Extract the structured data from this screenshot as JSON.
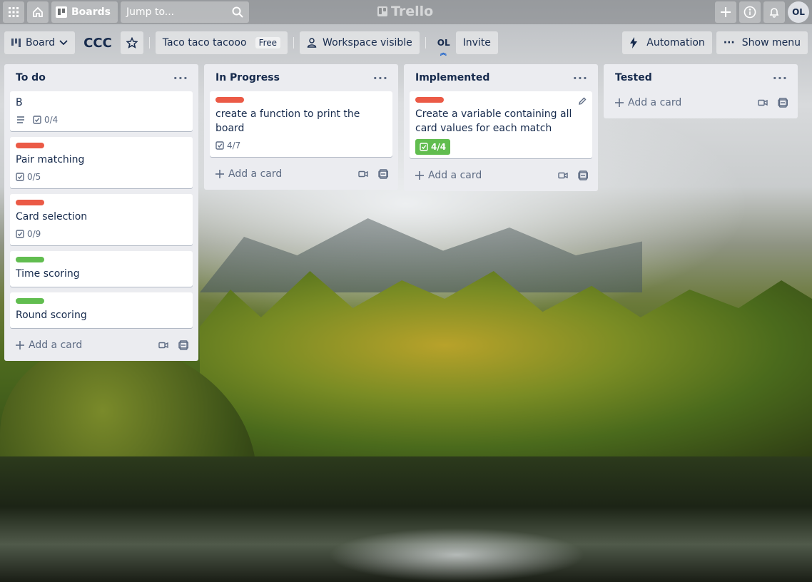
{
  "topnav": {
    "boards_label": "Boards",
    "search_placeholder": "Jump to...",
    "logo_text": "Trello",
    "avatar_initials": "OL"
  },
  "board": {
    "view_label": "Board",
    "title": "CCC",
    "workspace_name": "Taco taco tacooo",
    "plan_badge": "Free",
    "visibility_label": "Workspace visible",
    "member_initials": "OL",
    "invite_label": "Invite",
    "automation_label": "Automation",
    "show_menu_label": "Show menu"
  },
  "colors": {
    "label_red": "#eb5a46",
    "label_green": "#61bd4f"
  },
  "lists": [
    {
      "title": "To do",
      "add_card_label": "Add a card",
      "cards": [
        {
          "title": "B",
          "label": null,
          "has_description": true,
          "checklist": "0/4"
        },
        {
          "title": "Pair matching",
          "label": "red",
          "checklist": "0/5"
        },
        {
          "title": "Card selection",
          "label": "red",
          "checklist": "0/9"
        },
        {
          "title": "Time scoring",
          "label": "green"
        },
        {
          "title": "Round scoring",
          "label": "green"
        }
      ]
    },
    {
      "title": "In Progress",
      "add_card_label": "Add a card",
      "cards": [
        {
          "title": "create a function to print the board",
          "label": "red",
          "checklist": "4/7"
        }
      ]
    },
    {
      "title": "Implemented",
      "add_card_label": "Add a card",
      "cards": [
        {
          "title": "Create a variable containing all card values for each match",
          "label": "red",
          "checklist": "4/4",
          "checklist_complete": true
        }
      ]
    },
    {
      "title": "Tested",
      "add_card_label": "Add a card",
      "cards": []
    }
  ]
}
